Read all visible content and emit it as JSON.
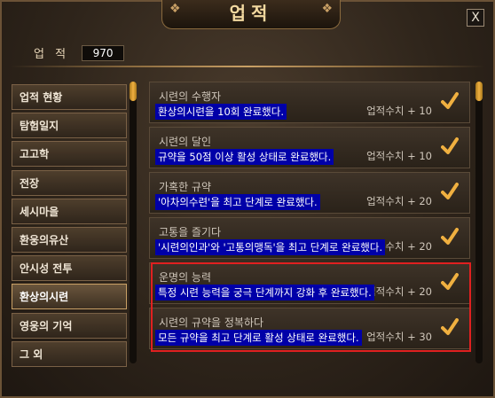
{
  "window": {
    "title": "업적",
    "close_label": "X"
  },
  "score": {
    "label": "업 적",
    "value": "970"
  },
  "sidebar": {
    "items": [
      {
        "label": "업적 현황",
        "active": false
      },
      {
        "label": "탐험일지",
        "active": false
      },
      {
        "label": "고고학",
        "active": false
      },
      {
        "label": "전장",
        "active": false
      },
      {
        "label": "세시마을",
        "active": false
      },
      {
        "label": "환웅의유산",
        "active": false
      },
      {
        "label": "안시성 전투",
        "active": false
      },
      {
        "label": "환상의시련",
        "active": true
      },
      {
        "label": "영웅의 기억",
        "active": false
      },
      {
        "label": "그 외",
        "active": false
      }
    ]
  },
  "achievements": [
    {
      "title": "시련의 수행자",
      "desc": "환상의시련을 10회 완료했다.",
      "score": "업적수치 + 10"
    },
    {
      "title": "시련의 달인",
      "desc": "규약을 50점 이상 활성 상태로 완료했다.",
      "score": "업적수치 + 10"
    },
    {
      "title": "가혹한 규약",
      "desc": "'아차의수련'을 최고 단계로 완료했다.",
      "score": "업적수치 + 20"
    },
    {
      "title": "고통을 즐기다",
      "desc": "'시련의인과'와 '고통의맹독'을 최고 단계로 완료했다.",
      "score": "업적수치 + 20"
    },
    {
      "title": "운명의 능력",
      "desc": "특정 시련 능력을 궁극 단계까지 강화 후 완료했다.",
      "score": "업적수치 + 20"
    },
    {
      "title": "시련의 규약을 정복하다",
      "desc": "모든 규약을 최고 단계로 활성 상태로 완료했다.",
      "score": "업적수치 + 30"
    }
  ],
  "colors": {
    "accent": "#f0b040",
    "highlight_border": "#e02020",
    "desc_bg": "#0000a8"
  }
}
